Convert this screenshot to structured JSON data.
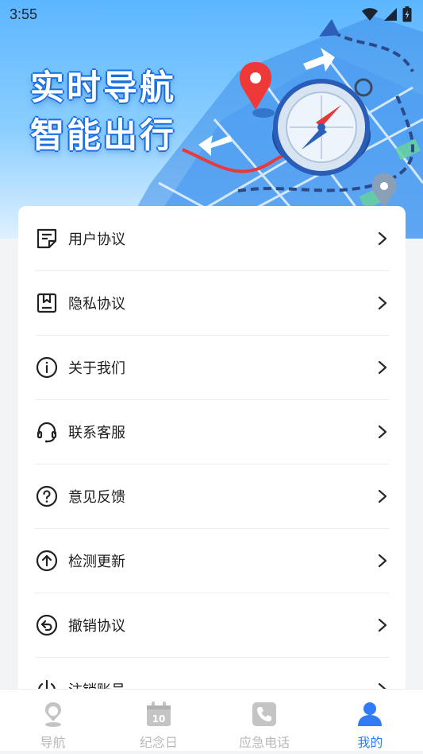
{
  "status_bar": {
    "time": "3:55"
  },
  "banner": {
    "slogan_line1": "实时导航",
    "slogan_line2": "智能出行"
  },
  "menu": {
    "items": [
      {
        "label": "用户协议",
        "icon": "document-list-icon"
      },
      {
        "label": "隐私协议",
        "icon": "bookmark-document-icon"
      },
      {
        "label": "关于我们",
        "icon": "info-circle-icon"
      },
      {
        "label": "联系客服",
        "icon": "headset-icon"
      },
      {
        "label": "意见反馈",
        "icon": "question-circle-icon"
      },
      {
        "label": "检测更新",
        "icon": "arrow-up-circle-icon"
      },
      {
        "label": "撤销协议",
        "icon": "undo-circle-icon"
      },
      {
        "label": "注销账号",
        "icon": "power-icon"
      }
    ]
  },
  "bottom_nav": {
    "items": [
      {
        "label": "导航",
        "icon": "location-pin-icon",
        "active": false
      },
      {
        "label": "纪念日",
        "icon": "calendar-icon",
        "active": false
      },
      {
        "label": "应急电话",
        "icon": "phone-icon",
        "active": false
      },
      {
        "label": "我的",
        "icon": "user-icon",
        "active": true
      }
    ]
  },
  "colors": {
    "accent": "#2f7cf6",
    "inactive": "#b8b8b8",
    "text": "#1f1f1f",
    "banner_top": "#5cb6ff"
  }
}
